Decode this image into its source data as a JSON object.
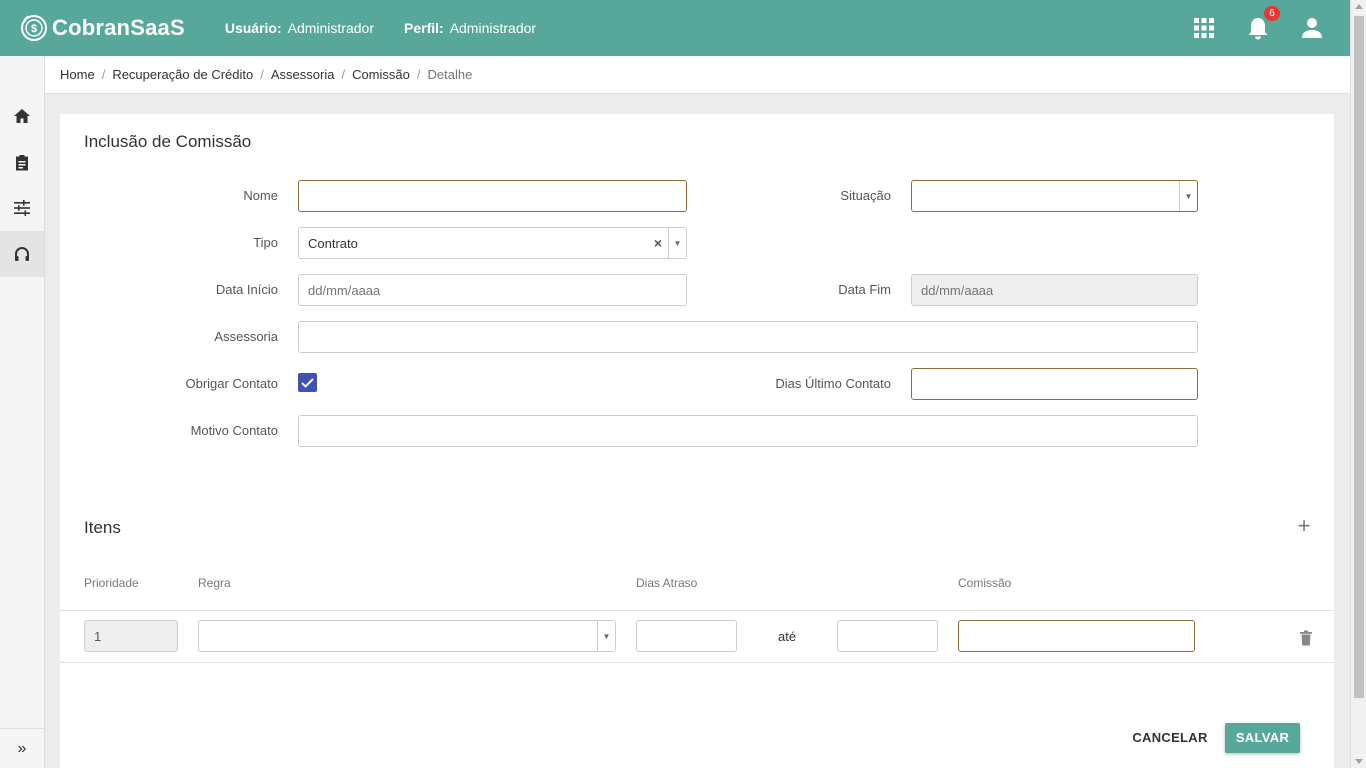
{
  "colors": {
    "header": "#57a89a",
    "primary_button": "#57a89a",
    "checkbox": "#3f51b5",
    "badge": "#e53935",
    "focus_border": "#8a6d3b"
  },
  "header": {
    "logo_text": "CobranSaaS",
    "user_label": "Usuário:",
    "user_value": "Administrador",
    "profile_label": "Perfil:",
    "profile_value": "Administrador",
    "icons": [
      "apps-grid-icon",
      "bell-icon",
      "user-icon"
    ],
    "notification_count": "6"
  },
  "sidebar": {
    "items": [
      {
        "icon": "home-icon"
      },
      {
        "icon": "clipboard-icon"
      },
      {
        "icon": "sliders-icon"
      },
      {
        "icon": "headset-icon",
        "active": true
      }
    ],
    "expand_label": "»"
  },
  "breadcrumb": [
    "Home",
    "Recuperação de Crédito",
    "Assessoria",
    "Comissão",
    "Detalhe"
  ],
  "form": {
    "title": "Inclusão de Comissão",
    "nome_label": "Nome",
    "nome_value": "",
    "situacao_label": "Situação",
    "situacao_value": "",
    "tipo_label": "Tipo",
    "tipo_value": "Contrato",
    "clear_glyph": "×",
    "data_inicio_label": "Data Início",
    "data_inicio_placeholder": "dd/mm/aaaa",
    "data_fim_label": "Data Fim",
    "data_fim_placeholder": "dd/mm/aaaa",
    "assessoria_label": "Assessoria",
    "assessoria_value": "",
    "obrigar_contato_label": "Obrigar Contato",
    "obrigar_contato_checked": true,
    "dias_ultimo_contato_label": "Dias Último Contato",
    "dias_ultimo_contato_value": "",
    "motivo_contato_label": "Motivo Contato",
    "motivo_contato_value": ""
  },
  "items": {
    "title": "Itens",
    "add_glyph": "+",
    "columns": [
      "Prioridade",
      "Regra",
      "Dias Atraso",
      "Comissão"
    ],
    "rows": [
      {
        "prioridade": "1",
        "regra": "",
        "dias_de": "",
        "ate": "até",
        "dias_ate": "",
        "comissao": ""
      }
    ]
  },
  "actions": {
    "cancel": "CANCELAR",
    "save": "SALVAR"
  }
}
